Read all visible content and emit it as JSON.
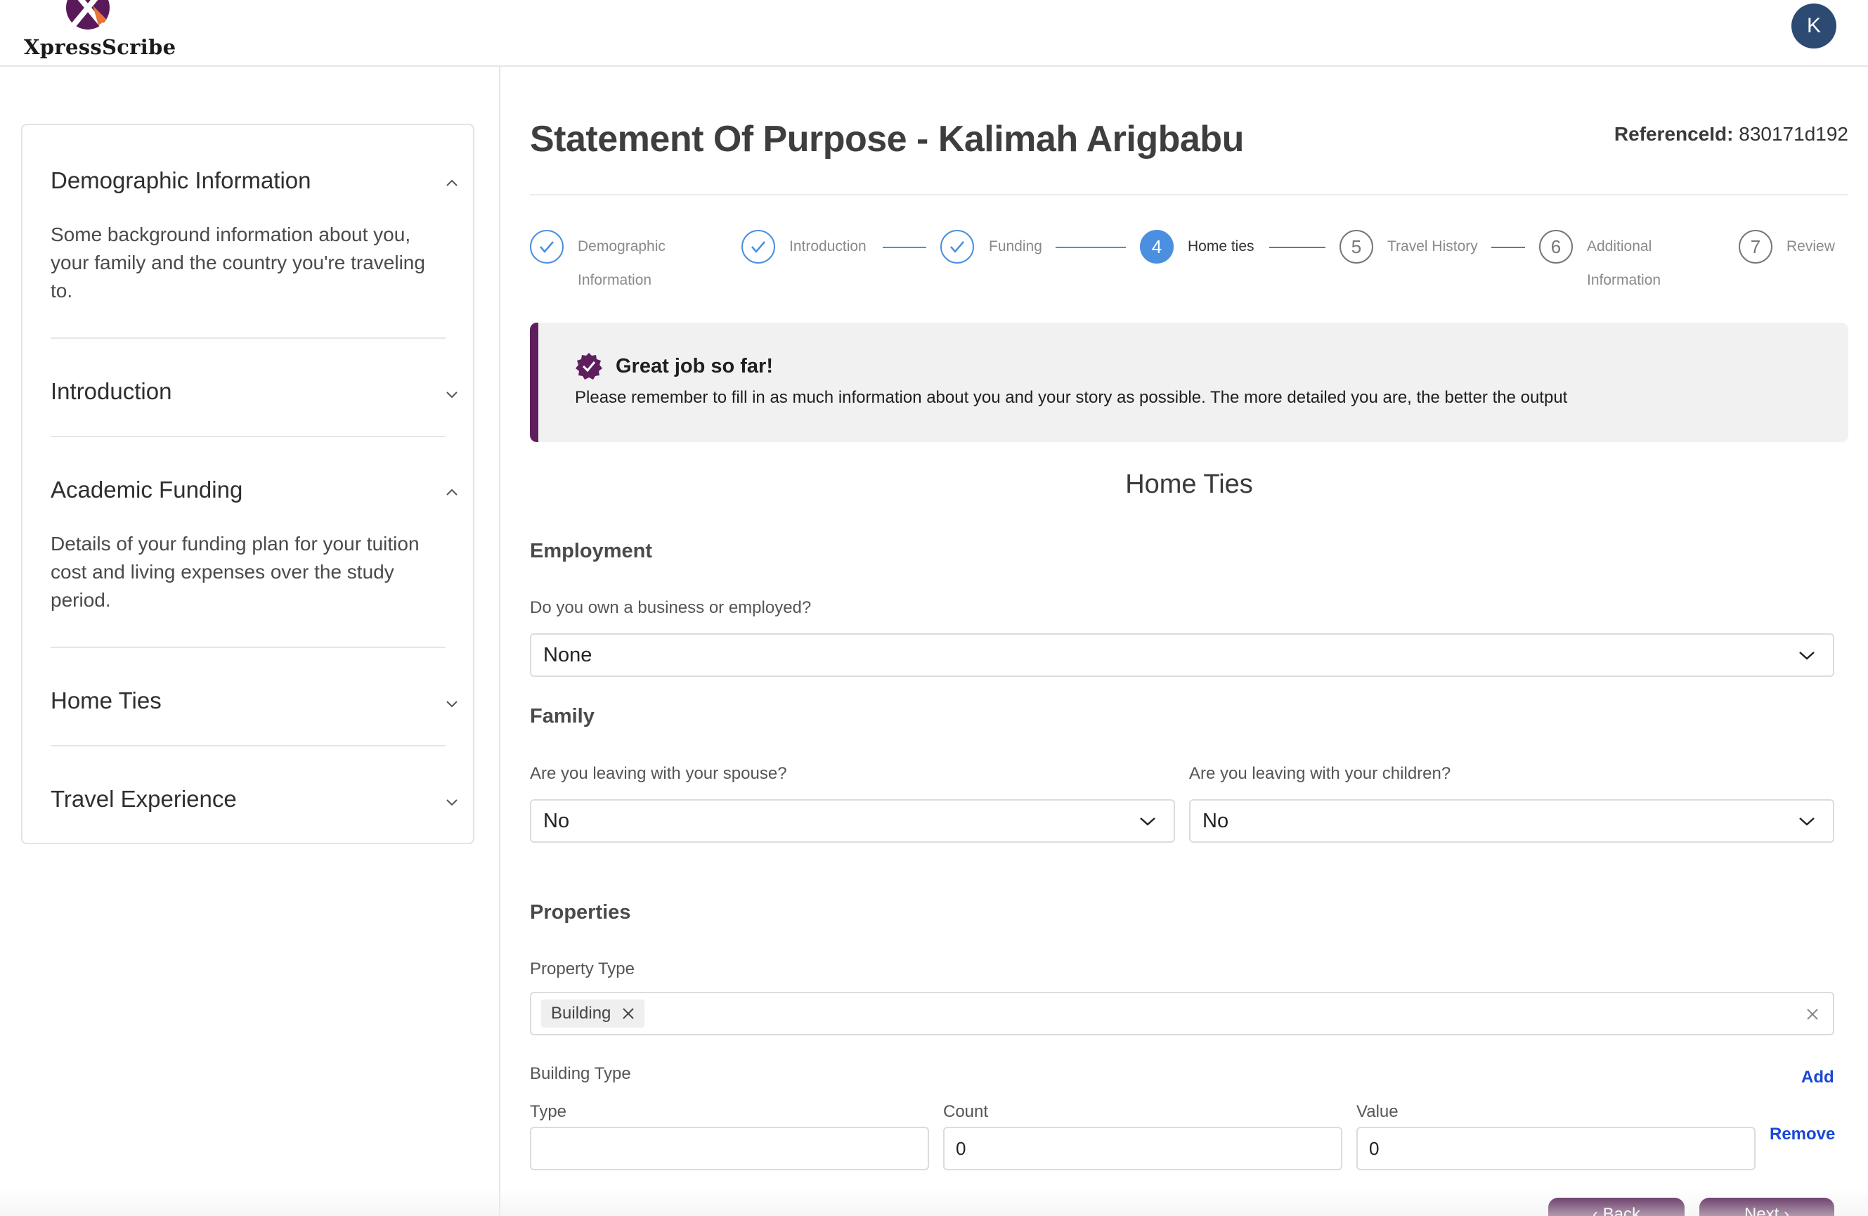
{
  "header": {
    "brand": "XpressScribe",
    "avatar_initial": "K",
    "logo_icon": "xpressscribe-logo-icon"
  },
  "sidebar": {
    "items": [
      {
        "title": "Demographic Information",
        "expanded": true,
        "description": "Some background information about you, your family and the country you're traveling to."
      },
      {
        "title": "Introduction",
        "expanded": false,
        "description": ""
      },
      {
        "title": "Academic Funding",
        "expanded": true,
        "description": "Details of your funding plan for your tuition cost and living expenses over the study period."
      },
      {
        "title": "Home Ties",
        "expanded": false,
        "description": ""
      },
      {
        "title": "Travel Experience",
        "expanded": false,
        "description": ""
      }
    ]
  },
  "main": {
    "title": "Statement Of Purpose - Kalimah Arigbabu",
    "reference_label": "ReferenceId:",
    "reference_value": "830171d192",
    "steps": [
      {
        "number": "1",
        "label_line1": "Demographic",
        "label_line2": "Information",
        "status": "complete"
      },
      {
        "number": "2",
        "label_line1": "Introduction",
        "label_line2": "",
        "status": "complete"
      },
      {
        "number": "3",
        "label_line1": "Funding",
        "label_line2": "",
        "status": "complete"
      },
      {
        "number": "4",
        "label_line1": "Home ties",
        "label_line2": "",
        "status": "active"
      },
      {
        "number": "5",
        "label_line1": "Travel History",
        "label_line2": "",
        "status": "pending"
      },
      {
        "number": "6",
        "label_line1": "Additional",
        "label_line2": "Information",
        "status": "pending"
      },
      {
        "number": "7",
        "label_line1": "Review",
        "label_line2": "",
        "status": "pending"
      }
    ],
    "alert": {
      "title": "Great job so far!",
      "body": "Please remember to fill in as much information about you and your story as possible. The more detailed you are, the better the output"
    },
    "section_title": "Home Ties",
    "employment": {
      "heading": "Employment",
      "question": "Do you own a business or employed?",
      "value": "None"
    },
    "family": {
      "heading": "Family",
      "spouse_question": "Are you leaving with your spouse?",
      "spouse_value": "No",
      "children_question": "Are you leaving with your children?",
      "children_value": "No"
    },
    "properties": {
      "heading": "Properties",
      "property_type_label": "Property Type",
      "selected_tags": [
        "Building"
      ],
      "building_type_label": "Building Type",
      "add_label": "Add",
      "type_label": "Type",
      "type_value": "",
      "count_label": "Count",
      "count_value": "0",
      "value_label": "Value",
      "value_value": "0",
      "remove_label": "Remove"
    },
    "buttons": {
      "back": "‹ Back",
      "next": "Next ›"
    }
  },
  "colors": {
    "brand_purple": "#5f1f5e",
    "step_blue": "#4a8fe0",
    "link_blue": "#1948d6",
    "avatar_bg": "#2d4a73"
  }
}
